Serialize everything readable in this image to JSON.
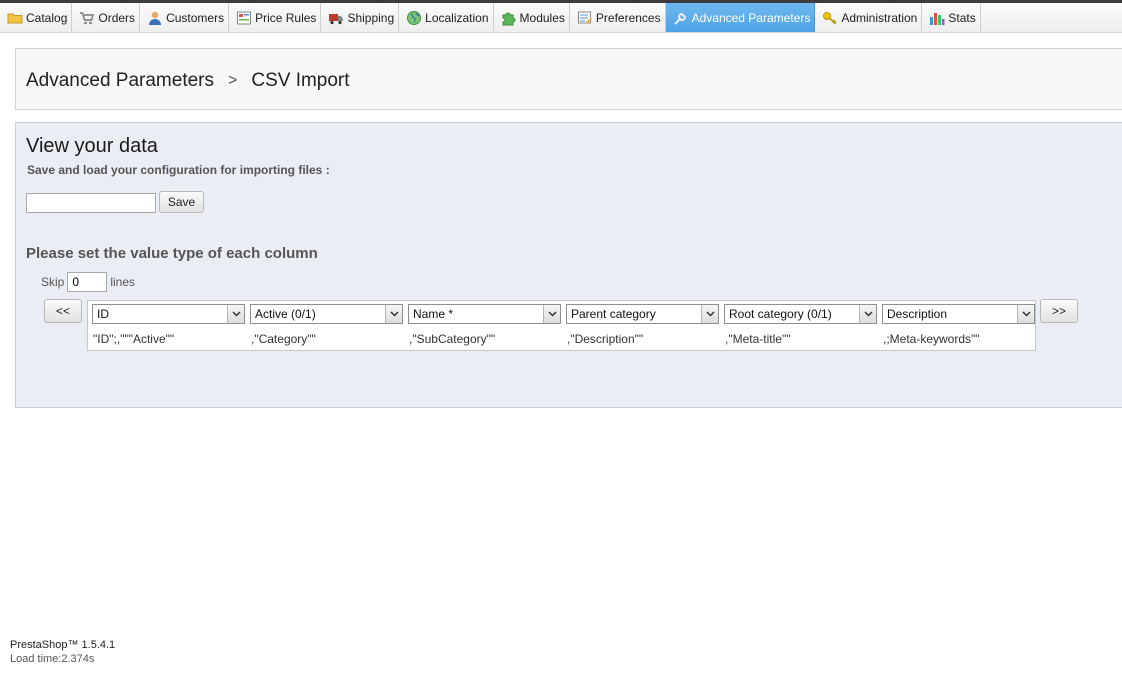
{
  "menu": {
    "tabs": [
      {
        "label": "Catalog",
        "icon": "folder-icon",
        "active": false
      },
      {
        "label": "Orders",
        "icon": "cart-icon",
        "active": false
      },
      {
        "label": "Customers",
        "icon": "user-icon",
        "active": false
      },
      {
        "label": "Price Rules",
        "icon": "price-tag-icon",
        "active": false
      },
      {
        "label": "Shipping",
        "icon": "truck-icon",
        "active": false
      },
      {
        "label": "Localization",
        "icon": "globe-icon",
        "active": false
      },
      {
        "label": "Modules",
        "icon": "puzzle-icon",
        "active": false
      },
      {
        "label": "Preferences",
        "icon": "preferences-icon",
        "active": false
      },
      {
        "label": "Advanced Parameters",
        "icon": "wrench-icon",
        "active": true
      },
      {
        "label": "Administration",
        "icon": "key-icon",
        "active": false
      },
      {
        "label": "Stats",
        "icon": "bar-chart-icon",
        "active": false
      }
    ]
  },
  "breadcrumb": {
    "parent": "Advanced Parameters",
    "separator": ">",
    "current": "CSV Import"
  },
  "panel": {
    "title": "View your data",
    "subtitle": "Save and load your configuration for importing files :",
    "config_name_value": "",
    "save_label": "Save",
    "columns_heading": "Please set the value type of each column",
    "skip_label": "Skip",
    "skip_value": "0",
    "lines_label": "lines",
    "prev_label": "<<",
    "next_label": ">>",
    "columns": [
      {
        "type": "ID",
        "value": "\"ID\";,\"\"\"Active\"\""
      },
      {
        "type": "Active (0/1)",
        "value": ",\"Category\"\""
      },
      {
        "type": "Name *",
        "value": ",\"SubCategory\"\""
      },
      {
        "type": "Parent category",
        "value": ",\"Description\"\""
      },
      {
        "type": "Root category (0/1)",
        "value": ",\"Meta-title\"\""
      },
      {
        "type": "Description",
        "value": ",;Meta-keywords\"\""
      }
    ]
  },
  "footer": {
    "version": "PrestaShop™ 1.5.4.1",
    "load_time": "Load time:2.374s"
  },
  "colors": {
    "active_tab": "#4da3e5",
    "panel_bg": "#ebedf4",
    "crumb_bg": "#f8f8f8"
  }
}
